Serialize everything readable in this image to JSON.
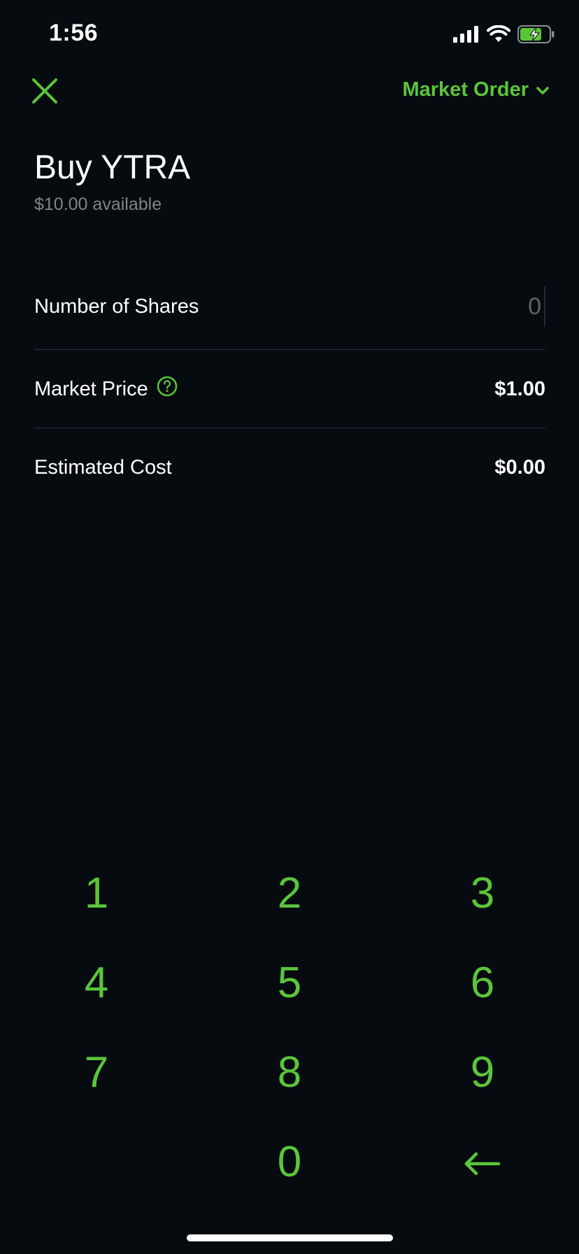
{
  "status_bar": {
    "time": "1:56",
    "signal_icon": "cellular-signal-icon",
    "wifi_icon": "wifi-icon",
    "battery_icon": "battery-charging-icon"
  },
  "header": {
    "close_icon": "close-icon",
    "order_type_label": "Market Order",
    "order_type_icon": "chevron-down-icon",
    "accent_color": "#5ac53b"
  },
  "title": {
    "heading": "Buy YTRA",
    "available": "$10.00 available"
  },
  "form": {
    "shares_label": "Number of Shares",
    "shares_placeholder": "0",
    "market_price_label": "Market Price",
    "market_price_help_icon": "help-circle-icon",
    "market_price_value": "$1.00",
    "estimated_cost_label": "Estimated Cost",
    "estimated_cost_value": "$0.00"
  },
  "keypad": {
    "keys": [
      "1",
      "2",
      "3",
      "4",
      "5",
      "6",
      "7",
      "8",
      "9",
      "0"
    ],
    "backspace_icon": "backspace-arrow-icon"
  }
}
